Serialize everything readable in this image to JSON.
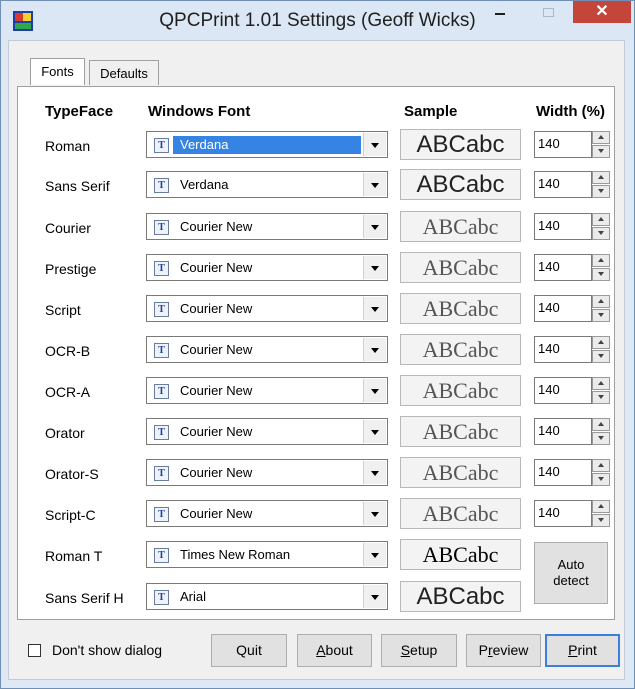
{
  "window": {
    "title": "QPCPrint 1.01 Settings (Geoff Wicks)",
    "close_glyph": "✕"
  },
  "tabs": [
    {
      "label": "Fonts",
      "active": true
    },
    {
      "label": "Defaults",
      "active": false
    }
  ],
  "headers": {
    "typeface": "TypeFace",
    "windows_font": "Windows Font",
    "sample": "Sample",
    "width": "Width (%)"
  },
  "rows": [
    {
      "typeface": "Roman",
      "font": "Verdana",
      "sample": "ABCabc",
      "width": "140",
      "selected": true
    },
    {
      "typeface": "Sans Serif",
      "font": "Verdana",
      "sample": "ABCabc",
      "width": "140"
    },
    {
      "typeface": "Courier",
      "font": "Courier New",
      "sample": "ABCabc",
      "width": "140"
    },
    {
      "typeface": "Prestige",
      "font": "Courier New",
      "sample": "ABCabc",
      "width": "140"
    },
    {
      "typeface": "Script",
      "font": "Courier New",
      "sample": "ABCabc",
      "width": "140"
    },
    {
      "typeface": "OCR-B",
      "font": "Courier New",
      "sample": "ABCabc",
      "width": "140"
    },
    {
      "typeface": "OCR-A",
      "font": "Courier New",
      "sample": "ABCabc",
      "width": "140"
    },
    {
      "typeface": "Orator",
      "font": "Courier New",
      "sample": "ABCabc",
      "width": "140"
    },
    {
      "typeface": "Orator-S",
      "font": "Courier New",
      "sample": "ABCabc",
      "width": "140"
    },
    {
      "typeface": "Script-C",
      "font": "Courier New",
      "sample": "ABCabc",
      "width": "140"
    },
    {
      "typeface": "Roman T",
      "font": "Times New Roman",
      "sample": "ABCabc"
    },
    {
      "typeface": "Sans Serif H",
      "font": "Arial",
      "sample": "ABCabc"
    }
  ],
  "auto_detect": {
    "line1": "Auto",
    "line2": "detect"
  },
  "bottom": {
    "dont_show": "Don't show dialog",
    "quit": "Quit",
    "about_u": "A",
    "about_rest": "bout",
    "setup_u": "S",
    "setup_rest": "etup",
    "preview_a": "P",
    "preview_u": "r",
    "preview_rest": "eview",
    "print_u": "P",
    "print_rest": "rint"
  },
  "colors": {
    "close_button": "#c4463a",
    "selection": "#3584e4",
    "default_button_border": "#3c7fd8"
  }
}
